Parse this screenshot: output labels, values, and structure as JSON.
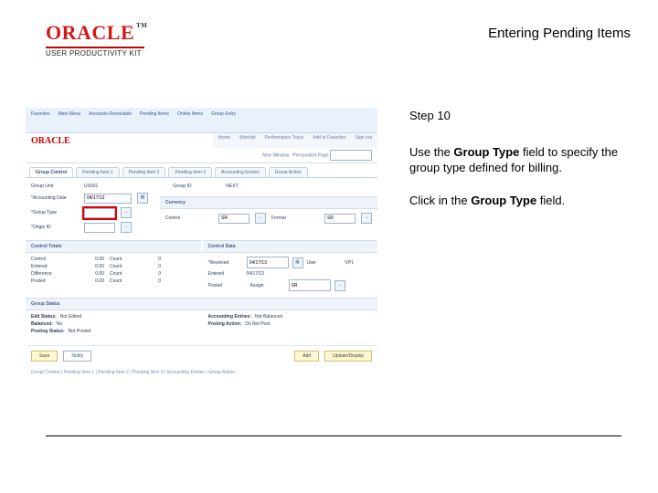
{
  "header": {
    "brand": "ORACLE",
    "tm": "TM",
    "productLine": "USER PRODUCTIVITY KIT",
    "pageTitle": "Entering Pending Items"
  },
  "instructions": {
    "stepLabel": "Step 10",
    "para1_a": "Use the ",
    "para1_b": "Group Type",
    "para1_c": " field to specify the group type defined for billing.",
    "para2_a": "Click in the ",
    "para2_b": "Group Type",
    "para2_c": " field."
  },
  "screenshot": {
    "topnav": [
      "Favorites",
      "Main Menu",
      "Accounts Receivable",
      "Pending Items",
      "Online Items",
      "Group Entry"
    ],
    "subnav": [
      "Home",
      "Worklist",
      "Performance Trace",
      "Add to Favorites",
      "Sign out"
    ],
    "brand": "ORACLE",
    "identity": {
      "label": "New Window",
      "personalize": "Personalize Page",
      "value": ""
    },
    "tabs": [
      "Group Control",
      "Pending Item 1",
      "Pending Item 2",
      "Pending Item 3",
      "Accounting Entries",
      "Group Action"
    ],
    "activeTab": 0,
    "groupUnitLabel": "Group Unit",
    "groupUnitValue": "US001",
    "groupIdLabel": "Group ID",
    "groupIdValue": "NEXT",
    "accountingDate": {
      "label": "*Accounting Date",
      "value": "04/17/13"
    },
    "groupType": {
      "label": "*Group Type",
      "value": ""
    },
    "originId": {
      "label": "*Origin ID",
      "value": ""
    },
    "currency": {
      "header": "Currency",
      "controlLabel": "Control",
      "controlValue": "SR",
      "formatLabel": "Format",
      "formatValue": "SR"
    },
    "controlTotals": {
      "header": "Control Totals",
      "rows": [
        {
          "name": "Control",
          "amt": "0.00",
          "cnt_l": "Count",
          "cnt": "0"
        },
        {
          "name": "Entered",
          "amt": "0.00",
          "cnt_l": "Count",
          "cnt": "0"
        },
        {
          "name": "Difference",
          "amt": "0.00",
          "cnt_l": "Count",
          "cnt": "0"
        },
        {
          "name": "Posted",
          "amt": "0.00",
          "cnt_l": "Count",
          "cnt": "0"
        }
      ]
    },
    "controlData": {
      "header": "Control Data",
      "received": {
        "label": "*Received",
        "value": "04/17/13"
      },
      "entered": {
        "label": "Entered",
        "value": "04/17/13"
      },
      "posted": {
        "label": "Posted",
        "value": ""
      },
      "assign": {
        "label": "Assign",
        "value": "SR"
      },
      "user": {
        "label": "User",
        "value": "VP1"
      }
    },
    "groupStatus": {
      "header": "Group Status",
      "editStatus": {
        "label": "Edit Status:",
        "value": "Not Edited"
      },
      "balanced": {
        "label": "Balanced:",
        "value": "No"
      },
      "postingStatus": {
        "label": "Posting Status:",
        "value": "Not Posted"
      },
      "acctEntries": {
        "label": "Accounting Entries:",
        "value": "Not Balanced"
      },
      "postingAction": {
        "label": "Posting Action:",
        "value": "Do Not Post"
      }
    },
    "footer": {
      "save": "Save",
      "notify": "Notify",
      "add": "Add",
      "update": "Update/Display"
    },
    "crumb": "Group Control | Pending Item 1 | Pending Item 2 | Pending Item 3 | Accounting Entries | Group Action"
  }
}
